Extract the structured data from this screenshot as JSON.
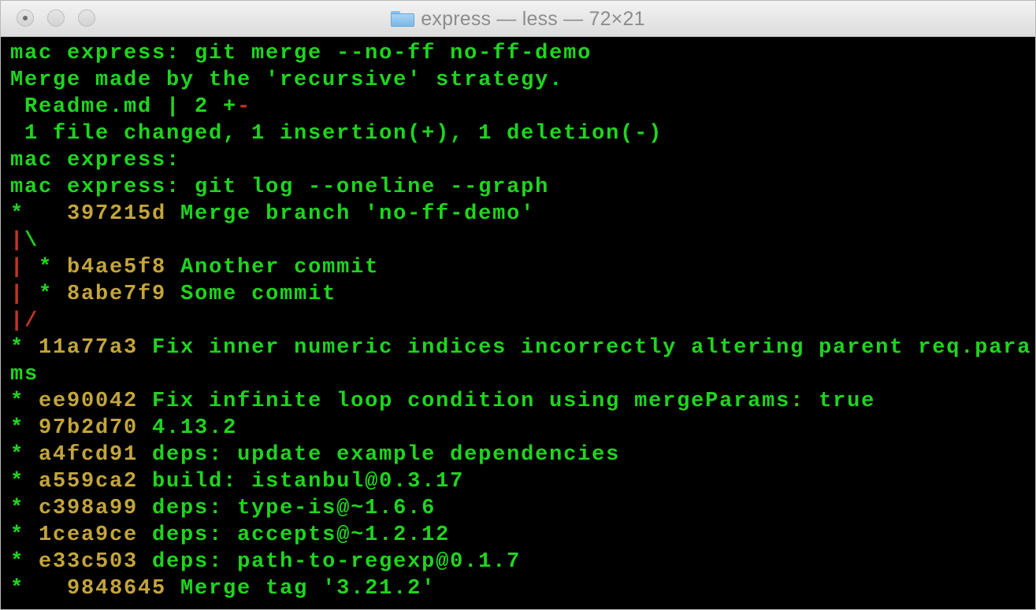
{
  "window": {
    "title": "express — less — 72×21"
  },
  "colors": {
    "background": "#000000",
    "text_green": "#1fd51f",
    "hash_yellow": "#c4a53b",
    "graph_red": "#c23621"
  },
  "terminal": {
    "lines": [
      [
        {
          "t": "mac express: git merge --no-ff no-ff-demo",
          "c": "g"
        }
      ],
      [
        {
          "t": "Merge made by the 'recursive' strategy.",
          "c": "g"
        }
      ],
      [
        {
          "t": " Readme.md | 2 +",
          "c": "g"
        },
        {
          "t": "-",
          "c": "r"
        }
      ],
      [
        {
          "t": " 1 file changed, 1 insertion(+), 1 deletion(-)",
          "c": "g"
        }
      ],
      [
        {
          "t": "mac express:",
          "c": "g"
        }
      ],
      [
        {
          "t": "mac express: git log --oneline --graph",
          "c": "g"
        }
      ],
      [
        {
          "t": "*   ",
          "c": "g"
        },
        {
          "t": "397215d",
          "c": "y"
        },
        {
          "t": " Merge branch 'no-ff-demo'",
          "c": "g"
        }
      ],
      [
        {
          "t": "|",
          "c": "r"
        },
        {
          "t": "\\",
          "c": "g"
        }
      ],
      [
        {
          "t": "|",
          "c": "r"
        },
        {
          "t": " * ",
          "c": "g"
        },
        {
          "t": "b4ae5f8",
          "c": "y"
        },
        {
          "t": " Another commit",
          "c": "g"
        }
      ],
      [
        {
          "t": "|",
          "c": "r"
        },
        {
          "t": " * ",
          "c": "g"
        },
        {
          "t": "8abe7f9",
          "c": "y"
        },
        {
          "t": " Some commit",
          "c": "g"
        }
      ],
      [
        {
          "t": "|/",
          "c": "r"
        }
      ],
      [
        {
          "t": "* ",
          "c": "g"
        },
        {
          "t": "11a77a3",
          "c": "y"
        },
        {
          "t": " Fix inner numeric indices incorrectly altering parent req.para",
          "c": "g"
        }
      ],
      [
        {
          "t": "ms",
          "c": "g"
        }
      ],
      [
        {
          "t": "* ",
          "c": "g"
        },
        {
          "t": "ee90042",
          "c": "y"
        },
        {
          "t": " Fix infinite loop condition using mergeParams: true",
          "c": "g"
        }
      ],
      [
        {
          "t": "* ",
          "c": "g"
        },
        {
          "t": "97b2d70",
          "c": "y"
        },
        {
          "t": " 4.13.2",
          "c": "g"
        }
      ],
      [
        {
          "t": "* ",
          "c": "g"
        },
        {
          "t": "a4fcd91",
          "c": "y"
        },
        {
          "t": " deps: update example dependencies",
          "c": "g"
        }
      ],
      [
        {
          "t": "* ",
          "c": "g"
        },
        {
          "t": "a559ca2",
          "c": "y"
        },
        {
          "t": " build: istanbul@0.3.17",
          "c": "g"
        }
      ],
      [
        {
          "t": "* ",
          "c": "g"
        },
        {
          "t": "c398a99",
          "c": "y"
        },
        {
          "t": " deps: type-is@~1.6.6",
          "c": "g"
        }
      ],
      [
        {
          "t": "* ",
          "c": "g"
        },
        {
          "t": "1cea9ce",
          "c": "y"
        },
        {
          "t": " deps: accepts@~1.2.12",
          "c": "g"
        }
      ],
      [
        {
          "t": "* ",
          "c": "g"
        },
        {
          "t": "e33c503",
          "c": "y"
        },
        {
          "t": " deps: path-to-regexp@0.1.7",
          "c": "g"
        }
      ],
      [
        {
          "t": "*   ",
          "c": "g"
        },
        {
          "t": "9848645",
          "c": "y"
        },
        {
          "t": " Merge tag '3.21.2'",
          "c": "g"
        }
      ]
    ]
  }
}
